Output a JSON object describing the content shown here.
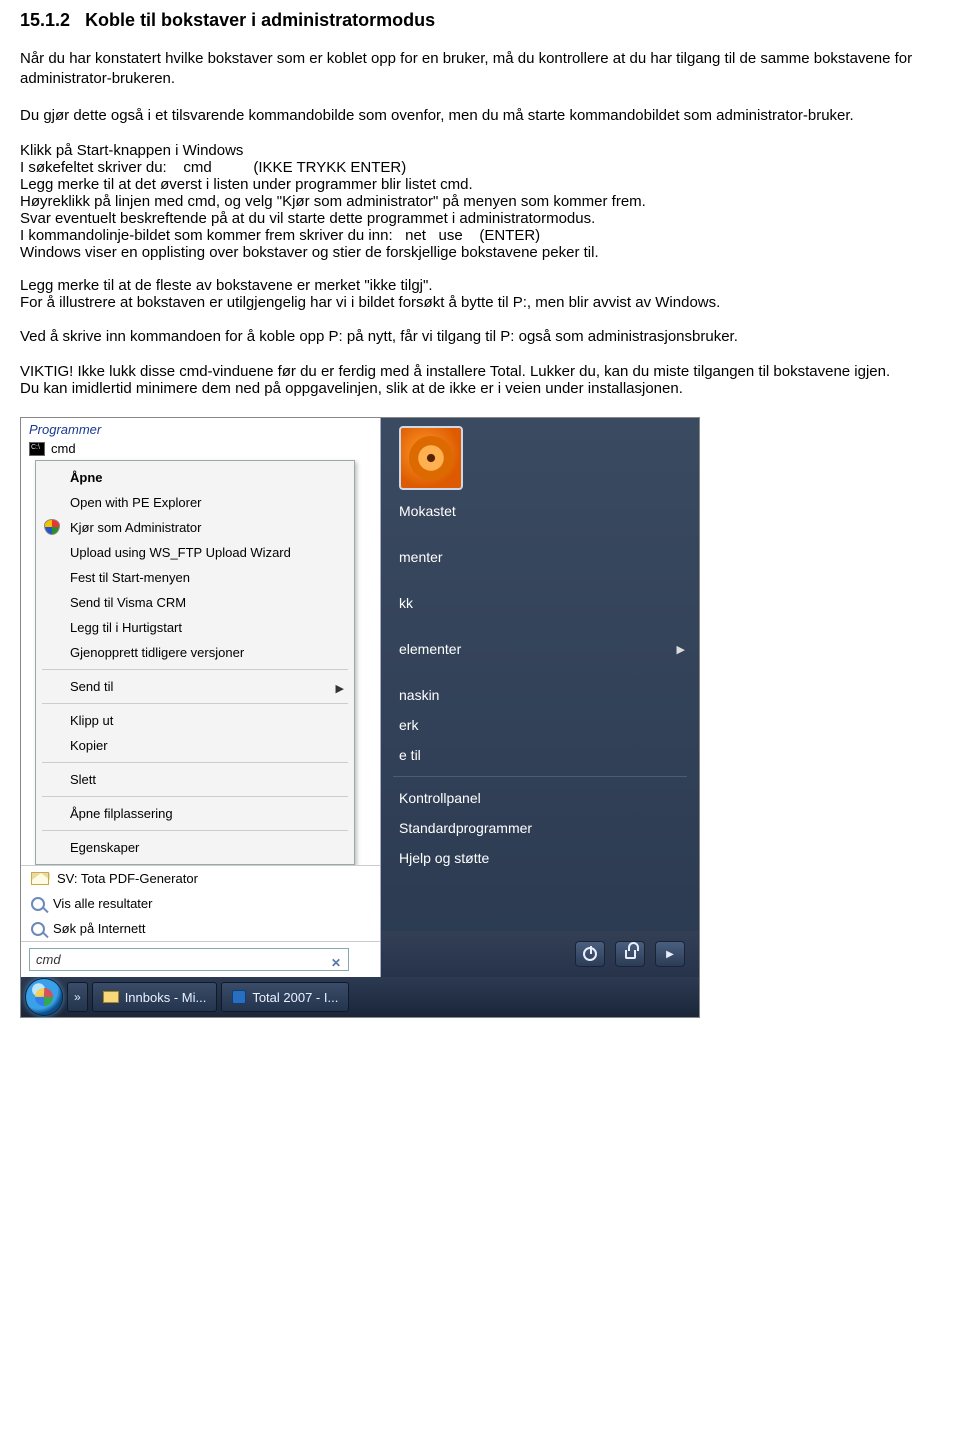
{
  "doc": {
    "heading_num": "15.1.2",
    "heading_text": "Koble til bokstaver i administratormodus",
    "p1": "Når du har konstatert hvilke bokstaver som er koblet opp for en bruker, må du kontrollere at du har tilgang til de samme bokstavene for administrator-brukeren.",
    "p2": "Du gjør dette også i et tilsvarende kommandobilde som ovenfor, men du må starte kommandobildet som administrator-bruker.",
    "p3a": "Klikk på Start-knappen i Windows",
    "p3b": "I søkefeltet skriver du:    cmd          (IKKE TRYKK ENTER)",
    "p3c": "Legg merke til at det øverst i listen under programmer blir listet cmd.",
    "p3d": "Høyreklikk på linjen med cmd, og velg \"Kjør som administrator\" på menyen som kommer frem.",
    "p3e": "Svar eventuelt beskreftende på at du vil starte dette programmet i administratormodus.",
    "p3f": "I kommandolinje-bildet som kommer frem skriver du inn:   net   use    (ENTER)",
    "p3g": "Windows viser en opplisting over bokstaver og stier de forskjellige bokstavene peker til.",
    "p4a": "Legg merke til at de fleste av bokstavene er merket \"ikke tilgj\".",
    "p4b": "For å illustrere at bokstaven er utilgjengelig har vi i bildet forsøkt å bytte til P:, men blir avvist av Windows.",
    "p5": "Ved å skrive inn kommandoen for å koble opp P: på nytt, får vi tilgang til P: også som administrasjonsbruker.",
    "p6a": "VIKTIG! Ikke lukk disse cmd-vinduene før du er ferdig med å installere Total. Lukker du, kan du miste tilgangen til bokstavene igjen.",
    "p6b": "Du kan imidlertid minimere dem ned på oppgavelinjen, slik at de ikke er i veien under installasjonen."
  },
  "menu": {
    "programs_header": "Programmer",
    "cmd_label": "cmd",
    "items": {
      "open": "Åpne",
      "pe": "Open with PE Explorer",
      "runas": "Kjør som Administrator",
      "wsftp": "Upload using WS_FTP Upload Wizard",
      "pin": "Fest til Start-menyen",
      "visma": "Send til Visma CRM",
      "quick": "Legg til i Hurtigstart",
      "restore": "Gjenopprett tidligere versjoner",
      "sendto": "Send til",
      "cut": "Klipp ut",
      "copy": "Kopier",
      "delete": "Slett",
      "openloc": "Åpne filplassering",
      "props": "Egenskaper"
    },
    "bottom": {
      "sv": "SV: Tota PDF-Generator",
      "allres": "Vis alle resultater",
      "inet": "Søk på Internett"
    },
    "search_value": "cmd"
  },
  "right": {
    "user": "Mokastet",
    "docs": "menter",
    "music": "kk",
    "recent": "elementer",
    "computer": "naskin",
    "network": "erk",
    "connect": "e til",
    "cp": "Kontrollpanel",
    "defprog": "Standardprogrammer",
    "help": "Hjelp og støtte"
  },
  "taskbar": {
    "inbox": "Innboks - Mi...",
    "total": "Total 2007 - I..."
  }
}
